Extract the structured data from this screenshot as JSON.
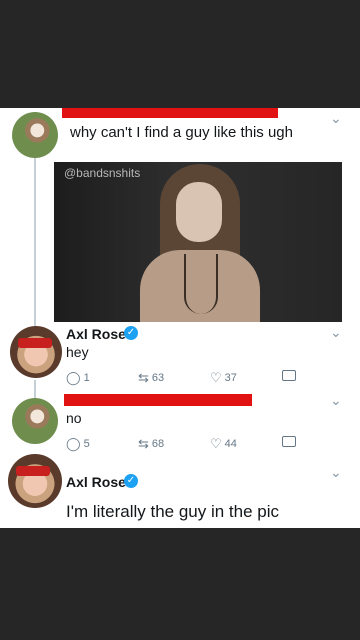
{
  "tweet1": {
    "text": "why can't I find a guy like this ugh",
    "image_handle": "@bandsnshits"
  },
  "reply1": {
    "name": "Axl Rose",
    "text": "hey",
    "replies": "1",
    "retweets": "63",
    "likes": "37"
  },
  "reply2": {
    "text": "no",
    "replies": "5",
    "retweets": "68",
    "likes": "44"
  },
  "reply3": {
    "name": "Axl Rose",
    "text": "I'm literally the guy in the pic"
  },
  "icons": {
    "reply": "reply-icon",
    "retweet": "retweet-icon",
    "like": "heart-icon",
    "dm": "mail-icon",
    "verified": "verified-badge-icon",
    "more": "chevron-down-icon"
  },
  "colors": {
    "verified": "#1da1f2",
    "redaction": "#e01212",
    "card": "#ffffff",
    "background": "#262626"
  }
}
